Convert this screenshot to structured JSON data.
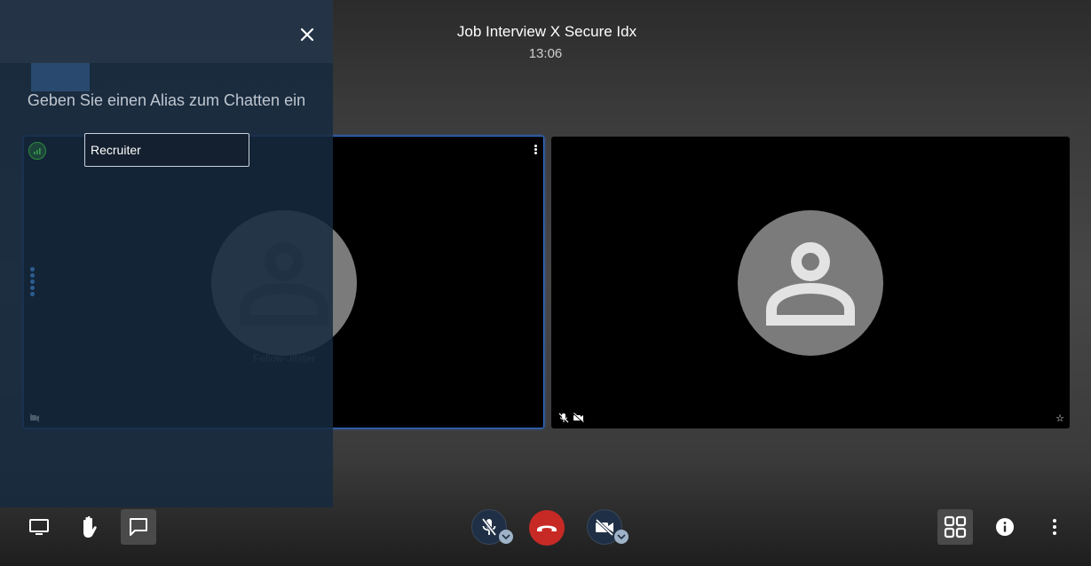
{
  "conference": {
    "title": "Job Interview X Secure Idx",
    "timer": "13:06"
  },
  "tiles": {
    "local": {
      "display_name": "Fellow Jitster"
    },
    "remote": {
      "display_name": ""
    }
  },
  "chat_panel": {
    "prompt": "Geben Sie einen Alias zum Chatten ein",
    "alias_value": "Recruiter"
  },
  "toolbar": {
    "left": [
      "screen-share-icon",
      "raise-hand-icon",
      "chat-icon"
    ],
    "center": [
      "microphone-muted-icon",
      "hangup-icon",
      "camera-off-icon"
    ],
    "right": [
      "tile-view-icon",
      "info-icon",
      "more-icon"
    ]
  },
  "colors": {
    "hangup": "#c72a25",
    "active_speaker_border": "#2f6dd4",
    "panel": "#162a40"
  }
}
